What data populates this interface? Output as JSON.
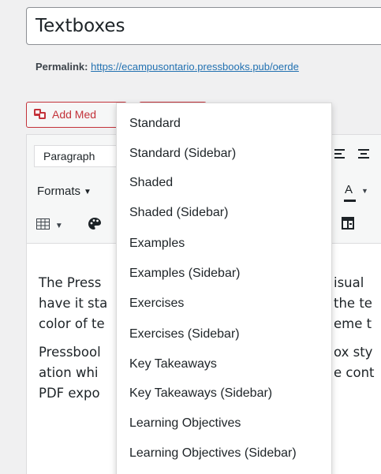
{
  "title_field": {
    "value": "Textboxes"
  },
  "permalink": {
    "label": "Permalink:",
    "url": "https://ecampusontario.pressbooks.pub/oerde"
  },
  "buttons": {
    "add_media": "Add Med"
  },
  "toolbar": {
    "paragraph_select": "Paragraph",
    "formats_label": "Formats",
    "font_color_letter": "A"
  },
  "content": {
    "paragraph1": [
      "The Press",
      "have it sta",
      "color of te"
    ],
    "paragraph1_right": [
      "isual",
      "the te",
      "eme t"
    ],
    "paragraph2": [
      "Pressbool",
      "ation whi",
      "PDF expo"
    ],
    "paragraph2_right": [
      "ox sty",
      "e cont"
    ]
  },
  "dropdown": {
    "items": [
      "Standard",
      "Standard (Sidebar)",
      "Shaded",
      "Shaded (Sidebar)",
      "Examples",
      "Examples (Sidebar)",
      "Exercises",
      "Exercises (Sidebar)",
      "Key Takeaways",
      "Key Takeaways (Sidebar)",
      "Learning Objectives",
      "Learning Objectives (Sidebar)"
    ]
  },
  "colors": {
    "accent_red": "#c3323a",
    "link_blue": "#2271b1",
    "background": "#f0f0f1"
  },
  "icons": [
    "media-icon",
    "table-icon",
    "palette-icon",
    "align-left-icon",
    "align-center-icon",
    "font-color-icon",
    "book-icon"
  ]
}
